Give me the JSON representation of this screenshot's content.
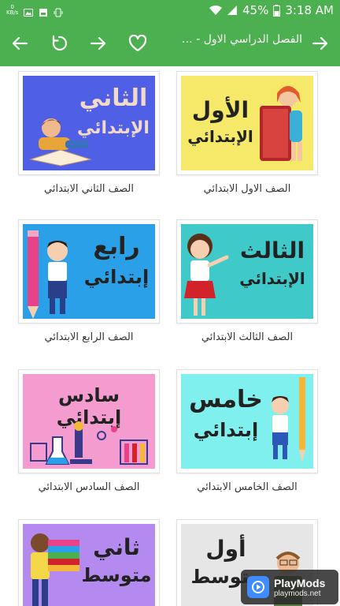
{
  "status_bar": {
    "time": "3:18 AM",
    "battery": "45%",
    "speed_value": "0",
    "speed_unit": "KB/s"
  },
  "app_bar": {
    "title": "الفصل الدراسي الاول - م..."
  },
  "grades": [
    {
      "caption": "الصف الاول الابتدائي",
      "thumb_line1": "الأول",
      "thumb_line2": "الإبتدائي",
      "bg": "#f6e96a"
    },
    {
      "caption": "الصف الثاني الابتدائي",
      "thumb_line1": "الثاني",
      "thumb_line2": "الإبتدائي",
      "bg": "#4f5fe6"
    },
    {
      "caption": "الصف الثالث الابتدائي",
      "thumb_line1": "الثالث",
      "thumb_line2": "الإبتدائي",
      "bg": "#3fc9c9"
    },
    {
      "caption": "الصف الرابع الابتدائي",
      "thumb_line1": "رابع",
      "thumb_line2": "إبتدائي",
      "bg": "#2aa0e8"
    },
    {
      "caption": "الصف الخامس الابتدائي",
      "thumb_line1": "خامس",
      "thumb_line2": "إبتدائي",
      "bg": "#7ff0ee"
    },
    {
      "caption": "الصف السادس الابتدائي",
      "thumb_line1": "سادس إبتدائي",
      "thumb_line2": "",
      "bg": "#f49ccf"
    },
    {
      "caption": "",
      "thumb_line1": "أول",
      "thumb_line2": "متوسط",
      "bg": "#e6e6e6"
    },
    {
      "caption": "",
      "thumb_line1": "ثاني",
      "thumb_line2": "متوسط",
      "bg": "#b58af0"
    }
  ],
  "watermark": {
    "name": "PlayMods",
    "url": "playmods.net"
  }
}
